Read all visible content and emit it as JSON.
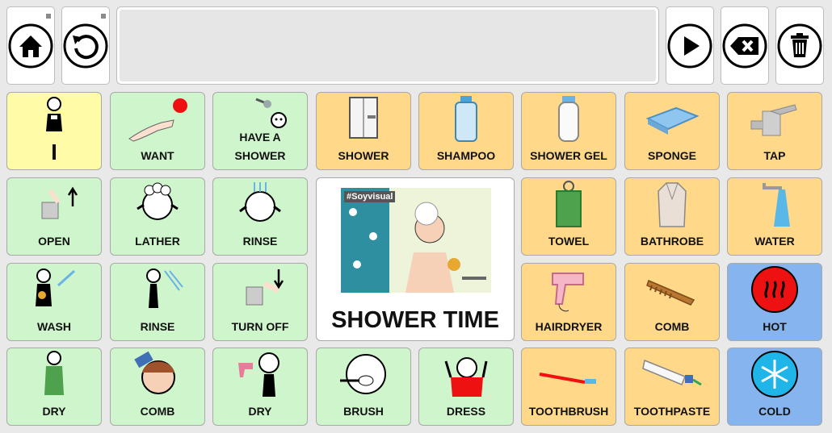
{
  "top_bar": {
    "home_icon": "home-icon",
    "reset_icon": "reset-icon",
    "play_icon": "play-icon",
    "backspace_icon": "backspace-icon",
    "trash_icon": "trash-icon"
  },
  "message": {
    "text": ""
  },
  "grid": {
    "i": "I",
    "want": "WANT",
    "have_a_shower": "HAVE A\nSHOWER",
    "shower": "SHOWER",
    "shampoo": "SHAMPOO",
    "shower_gel": "SHOWER GEL",
    "sponge": "SPONGE",
    "tap": "TAP",
    "open": "OPEN",
    "lather": "LATHER",
    "rinse1": "RINSE",
    "towel": "TOWEL",
    "bathrobe": "BATHROBE",
    "water": "WATER",
    "wash": "WASH",
    "rinse2": "RINSE",
    "turn_off": "TURN OFF",
    "hairdryer": "HAIRDRYER",
    "comb1": "COMB",
    "hot": "HOT",
    "dry1": "DRY",
    "comb2": "COMB",
    "dry2": "DRY",
    "brush": "BRUSH",
    "dress": "DRESS",
    "toothbrush": "TOOTHBRUSH",
    "toothpaste": "TOOTHPASTE",
    "cold": "COLD"
  },
  "center": {
    "title": "SHOWER TIME",
    "tag": "#Soyvisual"
  },
  "colors": {
    "yellow": "#fffba6",
    "green": "#cff5cc",
    "orange": "#ffd88a",
    "blue": "#86b4ef"
  }
}
